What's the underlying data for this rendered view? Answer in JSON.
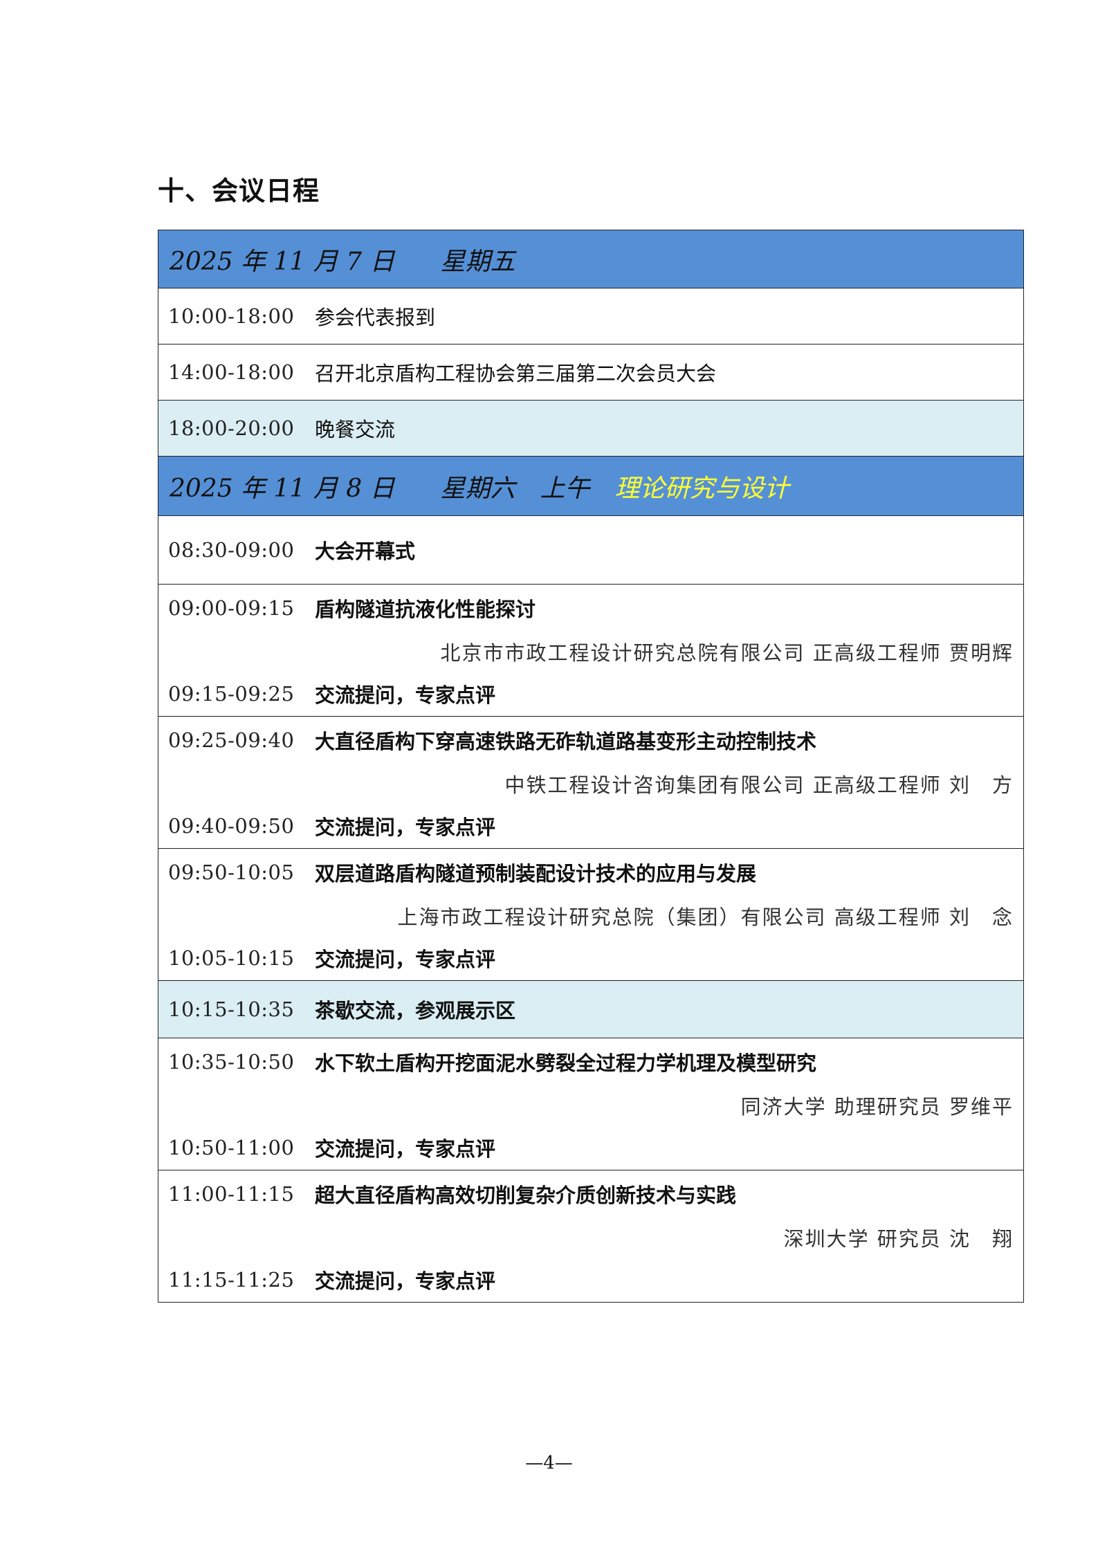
{
  "heading": "十、会议日程",
  "day1": {
    "date": "2025 年 11 月 7 日",
    "weekday": "星期五",
    "rows": [
      {
        "time": "10:00-18:00",
        "title": "参会代表报到"
      },
      {
        "time": "14:00-18:00",
        "title": "召开北京盾构工程协会第三届第二次会员大会"
      },
      {
        "time": "18:00-20:00",
        "title": "晚餐交流"
      }
    ]
  },
  "day2": {
    "date": "2025 年 11 月 8 日",
    "weekday": "星期六",
    "period": "上午",
    "theme": "理论研究与设计",
    "opening": {
      "time": "08:30-09:00",
      "title": "大会开幕式"
    },
    "talks": [
      {
        "time": "09:00-09:15",
        "title": "盾构隧道抗液化性能探讨",
        "speaker": "北京市市政工程设计研究总院有限公司 正高级工程师 贾明辉",
        "qa_time": "09:15-09:25",
        "qa": "交流提问，专家点评"
      },
      {
        "time": "09:25-09:40",
        "title": "大直径盾构下穿高速铁路无砟轨道路基变形主动控制技术",
        "speaker": "中铁工程设计咨询集团有限公司 正高级工程师 刘　方",
        "qa_time": "09:40-09:50",
        "qa": "交流提问，专家点评"
      },
      {
        "time": "09:50-10:05",
        "title": "双层道路盾构隧道预制装配设计技术的应用与发展",
        "speaker": "上海市政工程设计研究总院（集团）有限公司 高级工程师 刘　念",
        "qa_time": "10:05-10:15",
        "qa": "交流提问，专家点评"
      }
    ],
    "tea_break": {
      "time": "10:15-10:35",
      "title": "茶歇交流，参观展示区"
    },
    "talks2": [
      {
        "time": "10:35-10:50",
        "title": "水下软土盾构开挖面泥水劈裂全过程力学机理及模型研究",
        "speaker": "同济大学 助理研究员 罗维平",
        "qa_time": "10:50-11:00",
        "qa": "交流提问，专家点评"
      },
      {
        "time": "11:00-11:15",
        "title": "超大直径盾构高效切削复杂介质创新技术与实践",
        "speaker": "深圳大学 研究员 沈　翔",
        "qa_time": "11:15-11:25",
        "qa": "交流提问，专家点评"
      }
    ]
  },
  "page_number": "—4—",
  "colors": {
    "header_bg": "#5590d6",
    "break_bg": "#daeef3",
    "theme_text": "#ffff33"
  }
}
